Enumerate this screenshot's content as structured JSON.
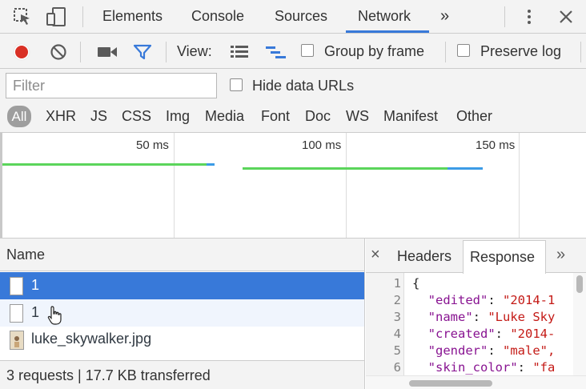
{
  "tabs": {
    "elements": "Elements",
    "console": "Console",
    "sources": "Sources",
    "network": "Network",
    "more": "»"
  },
  "toolbar": {
    "view_label": "View:",
    "group_by_frame": "Group by frame",
    "preserve_log": "Preserve log"
  },
  "filter": {
    "placeholder": "Filter",
    "hide_data_urls": "Hide data URLs"
  },
  "types": [
    "All",
    "XHR",
    "JS",
    "CSS",
    "Img",
    "Media",
    "Font",
    "Doc",
    "WS",
    "Manifest",
    "Other"
  ],
  "timeline": {
    "ticks": [
      "50 ms",
      "100 ms",
      "150 ms"
    ]
  },
  "requests": {
    "column_name": "Name",
    "rows": [
      {
        "name": "1"
      },
      {
        "name": "1"
      },
      {
        "name": "luke_skywalker.jpg"
      }
    ],
    "summary": "3 requests | 17.7 KB transferred"
  },
  "details": {
    "close": "×",
    "tabs": [
      "Headers",
      "Response"
    ],
    "more": "»",
    "active_tab": "Response",
    "line_numbers": [
      "1",
      "2",
      "3",
      "4",
      "5",
      "6",
      "7"
    ],
    "lines": [
      {
        "brace": "{"
      },
      {
        "key": "\"edited\"",
        "value": "\"2014-1"
      },
      {
        "key": "\"name\"",
        "value": "\"Luke Sky"
      },
      {
        "key": "\"created\"",
        "value": "\"2014-"
      },
      {
        "key": "\"gender\"",
        "value": "\"male\","
      },
      {
        "key": "\"skin_color\"",
        "value": "\"fa"
      }
    ]
  },
  "colors": {
    "accent": "#3879d9",
    "record": "#d93025",
    "bar_green": "#5bd55b",
    "bar_blue": "#3c9ce6"
  }
}
